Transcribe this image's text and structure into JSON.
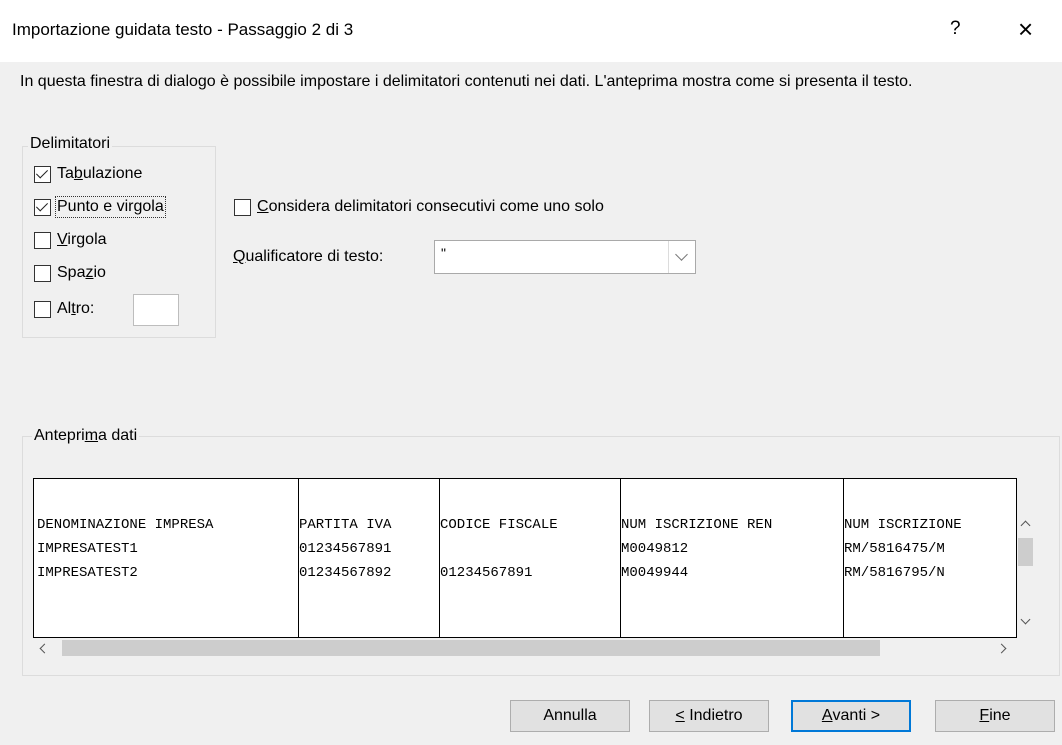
{
  "window": {
    "title": "Importazione guidata testo - Passaggio 2 di 3",
    "help": "?",
    "close": "×"
  },
  "description": "In questa finestra di dialogo è possibile impostare i delimitatori contenuti nei dati. L'anteprima mostra come si presenta il testo.",
  "delimiters": {
    "legend": "Delimitatori",
    "tab": {
      "pre": "Ta",
      "key": "b",
      "post": "ulazione",
      "checked": true
    },
    "semicolon": {
      "label": "Punto e virgola",
      "checked": true
    },
    "comma": {
      "key": "V",
      "post": "irgola",
      "checked": false
    },
    "space": {
      "pre": "Spa",
      "key": "z",
      "post": "io",
      "checked": false
    },
    "other": {
      "pre": "Al",
      "key": "t",
      "post": "ro:",
      "checked": false,
      "value": ""
    }
  },
  "consecutive": {
    "key": "C",
    "post": "onsidera delimitatori consecutivi come uno solo",
    "checked": false
  },
  "qualifier": {
    "key": "Q",
    "post": "ualificatore di testo:",
    "value": "\""
  },
  "preview": {
    "legend_pre": "Antepri",
    "legend_key": "m",
    "legend_post": "a dati",
    "rows": [
      [
        "DENOMINAZIONE IMPRESA",
        "PARTITA IVA",
        "CODICE FISCALE",
        "NUM ISCRIZIONE REN",
        "NUM ISCRIZIONE"
      ],
      [
        "IMPRESATEST1",
        "01234567891",
        "",
        "M0049812",
        "RM/5816475/M"
      ],
      [
        "IMPRESATEST2",
        "01234567892",
        "01234567891",
        "M0049944",
        "RM/5816795/N"
      ]
    ]
  },
  "buttons": {
    "cancel": "Annulla",
    "back_key": "<",
    "back_post": " Indietro",
    "next_key": "A",
    "next_post": "vanti >",
    "finish_key": "F",
    "finish_post": "ine"
  }
}
